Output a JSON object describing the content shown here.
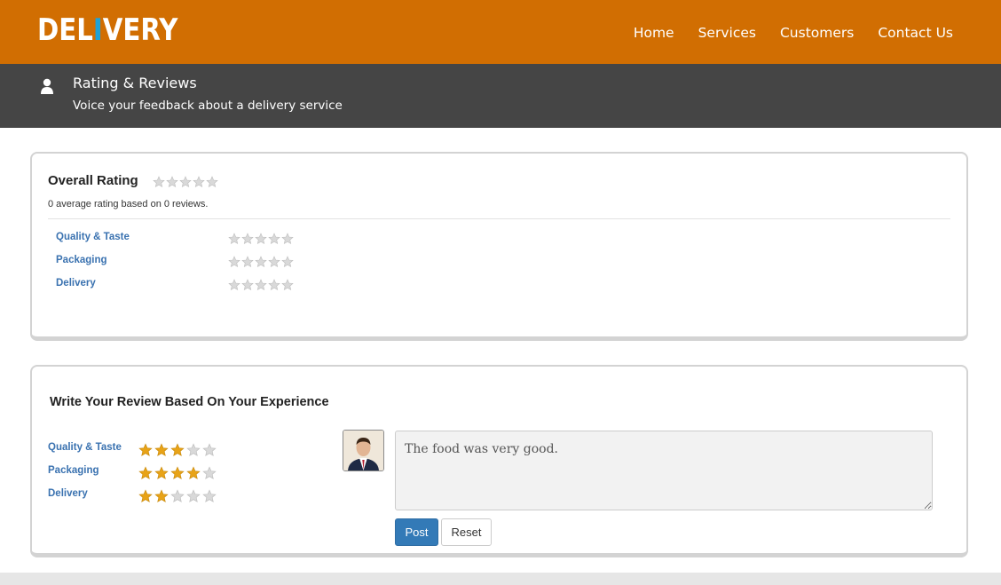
{
  "brand": {
    "logo_part1": "DEL",
    "logo_accent": "I",
    "logo_part2": "VERY",
    "primary_color": "#d16e02",
    "accent_color": "#1fa2d6",
    "header_dark": "#454545"
  },
  "nav": {
    "items": [
      {
        "label": "Home"
      },
      {
        "label": "Services"
      },
      {
        "label": "Customers"
      },
      {
        "label": "Contact Us"
      }
    ]
  },
  "subheader": {
    "icon": "user-icon",
    "title": "Rating & Reviews",
    "description": "Voice your feedback about a delivery service"
  },
  "overall": {
    "title": "Overall Rating",
    "rating": 0,
    "max_rating": 5,
    "summary": "0 average rating based on 0 reviews.",
    "categories": [
      {
        "label": "Quality & Taste",
        "rating": 0
      },
      {
        "label": "Packaging",
        "rating": 0
      },
      {
        "label": "Delivery",
        "rating": 0
      }
    ]
  },
  "review_form": {
    "title": "Write Your Review Based On Your Experience",
    "categories": [
      {
        "label": "Quality & Taste",
        "rating": 3
      },
      {
        "label": "Packaging",
        "rating": 4
      },
      {
        "label": "Delivery",
        "rating": 2
      }
    ],
    "review_text": "The food was very good.",
    "post_label": "Post",
    "reset_label": "Reset",
    "star_filled_color": "#e8a317",
    "star_empty_color": "#d9d9d9"
  }
}
